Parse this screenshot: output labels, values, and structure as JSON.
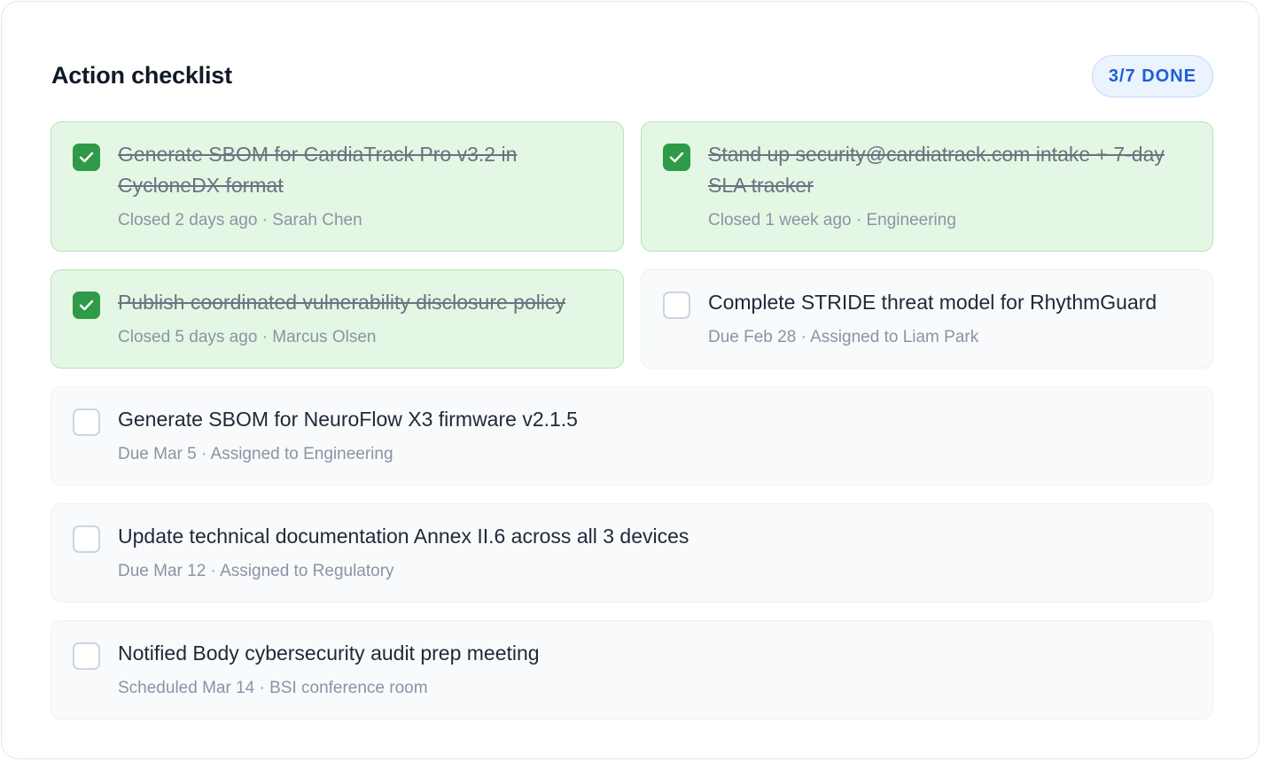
{
  "header": {
    "title": "Action checklist",
    "badge": "3/7 DONE"
  },
  "colors": {
    "done_background": "#e4f7e4",
    "done_border": "#b6e3b8",
    "check_green": "#2f9a48",
    "badge_text": "#1c5fd6",
    "badge_background": "#eaf3fe"
  },
  "items": [
    {
      "title": "Generate SBOM for CardiaTrack Pro v3.2 in CycloneDX format",
      "meta": "Closed 2 days ago · Sarah Chen",
      "done": true
    },
    {
      "title": "Stand up security@cardiatrack.com intake + 7-day SLA tracker",
      "meta": "Closed 1 week ago · Engineering",
      "done": true
    },
    {
      "title": "Publish coordinated vulnerability disclosure policy",
      "meta": "Closed 5 days ago · Marcus Olsen",
      "done": true
    },
    {
      "title": "Complete STRIDE threat model for RhythmGuard",
      "meta": "Due Feb 28 · Assigned to Liam Park",
      "done": false
    },
    {
      "title": "Generate SBOM for NeuroFlow X3 firmware v2.1.5",
      "meta": "Due Mar 5 · Assigned to Engineering",
      "done": false
    },
    {
      "title": "Update technical documentation Annex II.6 across all 3 devices",
      "meta": "Due Mar 12 · Assigned to Regulatory",
      "done": false
    },
    {
      "title": "Notified Body cybersecurity audit prep meeting",
      "meta": "Scheduled Mar 14 · BSI conference room",
      "done": false
    }
  ]
}
